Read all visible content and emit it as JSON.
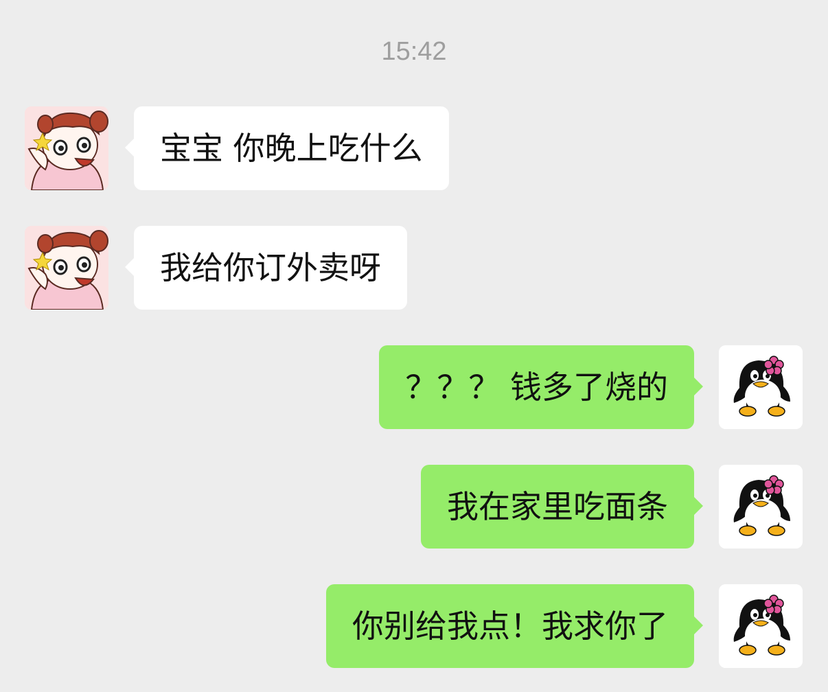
{
  "chat": {
    "timestamp": "15:42",
    "messages": [
      {
        "side": "incoming",
        "sender_avatar": "girl-avatar",
        "text": "宝宝 你晚上吃什么"
      },
      {
        "side": "incoming",
        "sender_avatar": "girl-avatar",
        "text": "我给你订外卖呀"
      },
      {
        "side": "outgoing",
        "sender_avatar": "penguin-avatar",
        "text": "？？？ 钱多了烧的"
      },
      {
        "side": "outgoing",
        "sender_avatar": "penguin-avatar",
        "text": "我在家里吃面条"
      },
      {
        "side": "outgoing",
        "sender_avatar": "penguin-avatar",
        "text": "你别给我点！我求你了"
      }
    ]
  },
  "colors": {
    "background": "#ededed",
    "incoming_bubble": "#ffffff",
    "outgoing_bubble": "#95ec69",
    "timestamp": "#9e9e9e"
  }
}
